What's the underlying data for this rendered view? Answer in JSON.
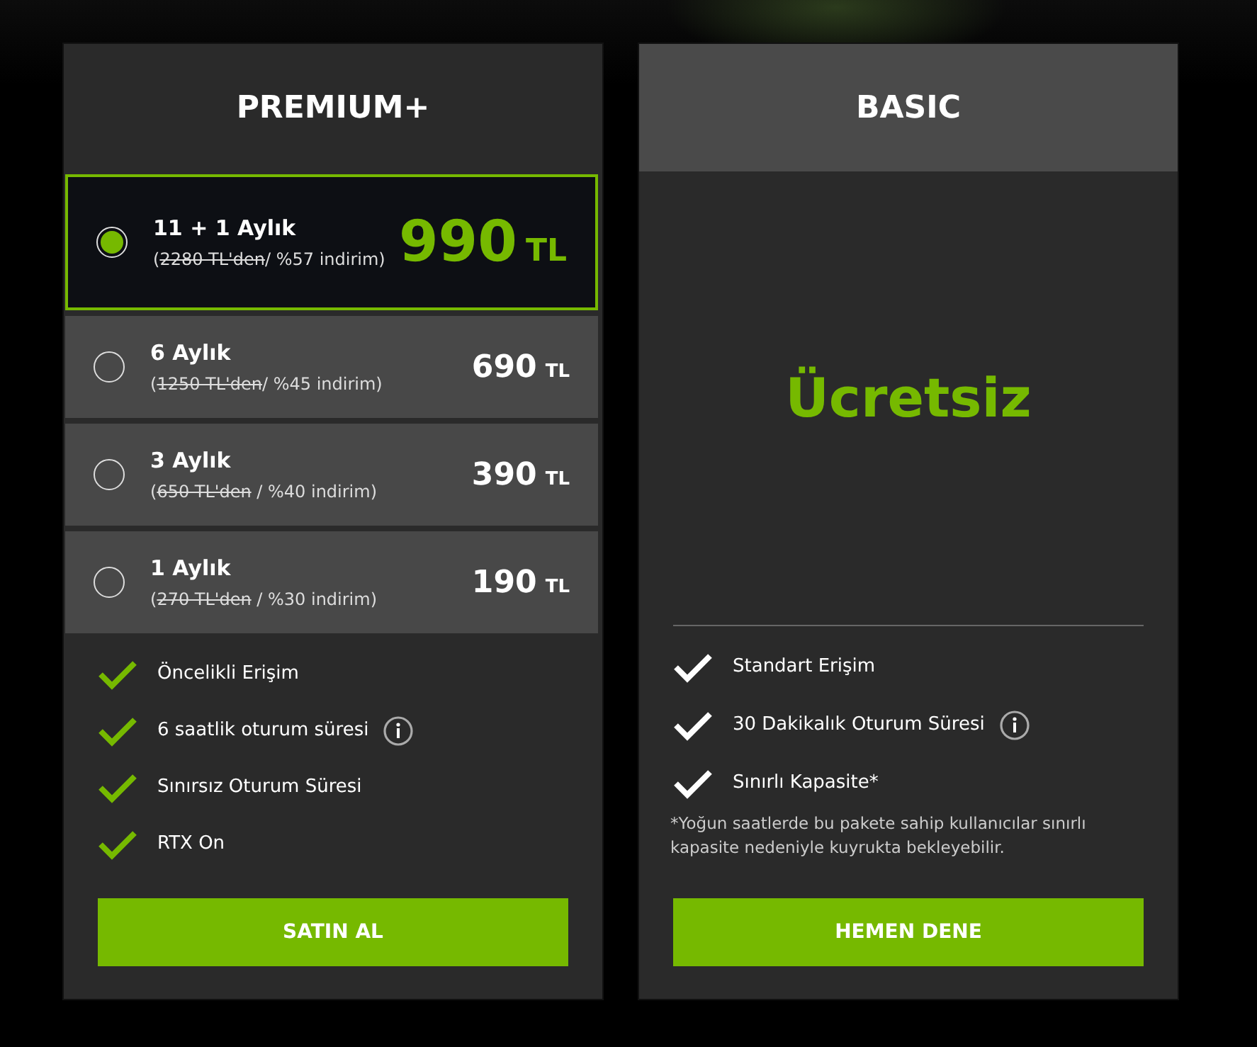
{
  "plans": [
    {
      "kind": "options",
      "title": "PREMIUM+",
      "options": [
        {
          "selected": true,
          "label": "11 + 1 Aylık",
          "note": {
            "before": "(",
            "struck": "2280 TL'den",
            "after": "/ %57 indirim)"
          },
          "price": "990",
          "currency": "TL"
        },
        {
          "selected": false,
          "label": "6 Aylık",
          "note": {
            "before": "(",
            "struck": "1250 TL'den",
            "after": "/ %45 indirim)"
          },
          "price": "690",
          "currency": "TL"
        },
        {
          "selected": false,
          "label": "3 Aylık",
          "note": {
            "before": "(",
            "struck": "650 TL'den",
            "after": " / %40 indirim)"
          },
          "price": "390",
          "currency": "TL"
        },
        {
          "selected": false,
          "label": "1 Aylık",
          "note": {
            "before": "(",
            "struck": "270 TL'den",
            "after": " / %30 indirim)"
          },
          "price": "190",
          "currency": "TL"
        }
      ],
      "features": [
        {
          "text": "Öncelikli Erişim",
          "info": false
        },
        {
          "text": "6 saatlik oturum süresi",
          "info": true
        },
        {
          "text": "Sınırsız Oturum Süresi",
          "info": false
        },
        {
          "text": "RTX On",
          "info": false
        }
      ],
      "button": "SATIN AL"
    },
    {
      "kind": "free",
      "title": "BASIC",
      "price": "Ücretsiz",
      "features": [
        {
          "text": "Standart Erişim",
          "info": false
        },
        {
          "text": "30 Dakikalık Oturum Süresi",
          "info": true
        },
        {
          "text": "Sınırlı Kapasite*",
          "info": false
        }
      ],
      "footnote": "*Yoğun saatlerde bu pakete sahip kullanıcılar sınırlı kapasite nedeniyle kuyrukta bekleyebilir.",
      "button": "HEMEN DENE"
    }
  ]
}
